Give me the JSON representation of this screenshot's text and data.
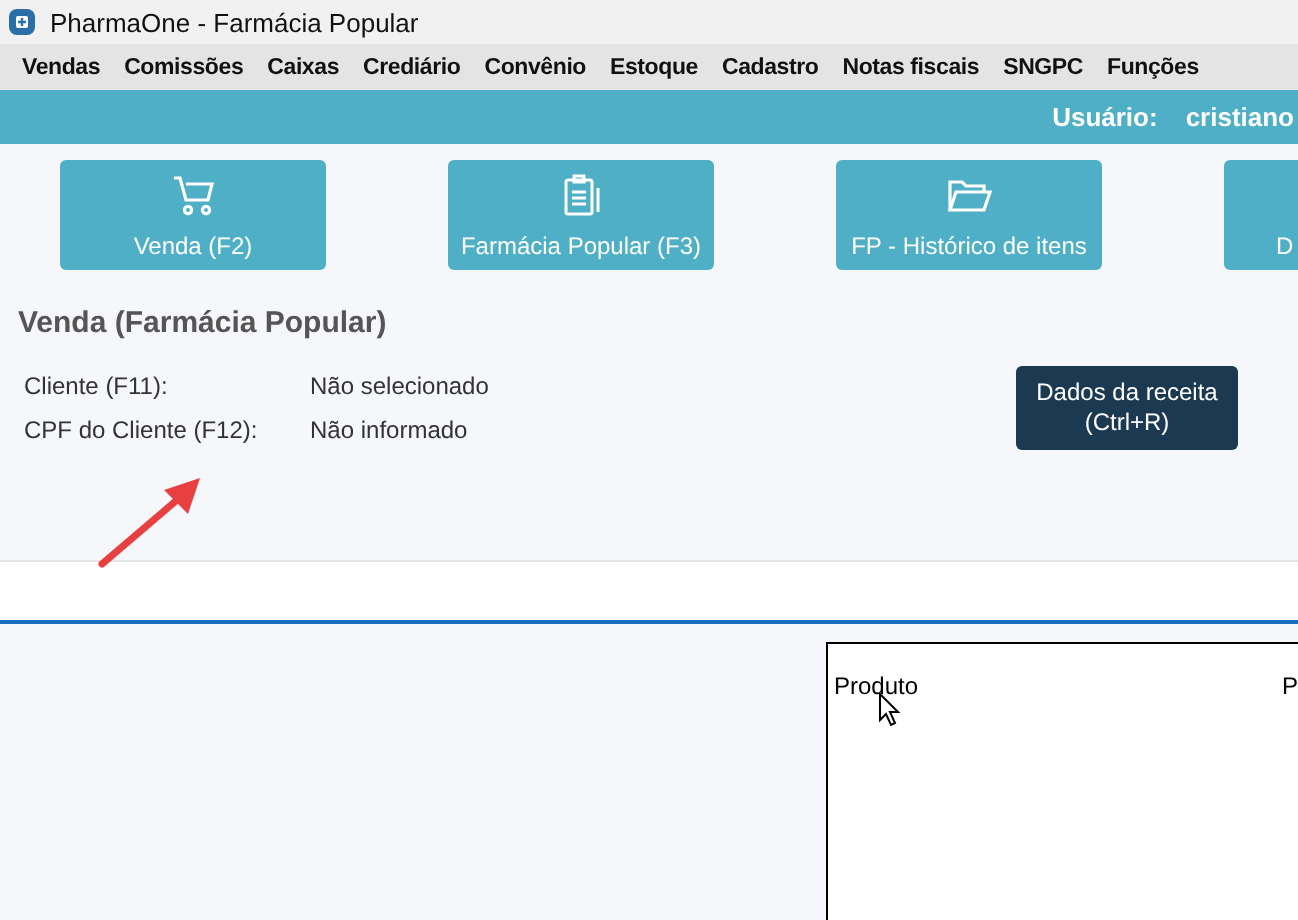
{
  "window": {
    "title": "PharmaOne - Farmácia Popular"
  },
  "menu": [
    "Vendas",
    "Comissões",
    "Caixas",
    "Crediário",
    "Convênio",
    "Estoque",
    "Cadastro",
    "Notas fiscais",
    "SNGPC",
    "Funções"
  ],
  "user_bar": {
    "label": "Usuário:",
    "value": "cristiano"
  },
  "toolbar": [
    {
      "label": "Venda (F2)",
      "kind": "cart"
    },
    {
      "label": "Farmácia Popular (F3)",
      "kind": "clipboard"
    },
    {
      "label": "FP - Histórico de itens",
      "kind": "folder"
    },
    {
      "label": "D",
      "kind": "none"
    }
  ],
  "heading": "Venda (Farmácia Popular)",
  "fields": [
    {
      "label": "Cliente (F11):",
      "value": "Não selecionado"
    },
    {
      "label": "CPF do Cliente (F12):",
      "value": "Não informado"
    }
  ],
  "prescription_button": {
    "line1": "Dados da receita",
    "line2": "(Ctrl+R)"
  },
  "table": {
    "columns": [
      "Produto",
      "P"
    ]
  }
}
